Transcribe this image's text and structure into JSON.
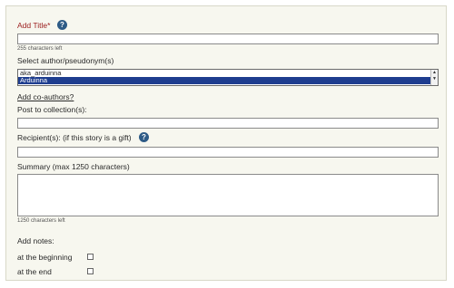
{
  "title_field": {
    "label": "Add Title*",
    "help": "?",
    "counter": "255 characters left",
    "value": ""
  },
  "author": {
    "label": "Select author/pseudonym(s)",
    "options": [
      "aka_arduinna",
      "Arduinna"
    ],
    "selected": "Arduinna",
    "scroll_up": "▲",
    "scroll_down": "▼"
  },
  "coauthors_link": "Add co-authors?",
  "collection": {
    "label": "Post to collection(s):",
    "value": ""
  },
  "recipient": {
    "label": "Recipient(s): (if this story is a gift)",
    "help": "?",
    "value": ""
  },
  "summary": {
    "label": "Summary (max 1250 characters)",
    "counter": "1250 characters left",
    "value": ""
  },
  "notes": {
    "label": "Add notes:",
    "beginning_label": "at the beginning",
    "end_label": "at the end",
    "beginning_checked": false,
    "end_checked": false
  },
  "colors": {
    "title_label": "#9b1c1c",
    "help_icon": "#2e5b86",
    "selected_option": "#1e3d8f",
    "panel": "#f7f7ef"
  }
}
